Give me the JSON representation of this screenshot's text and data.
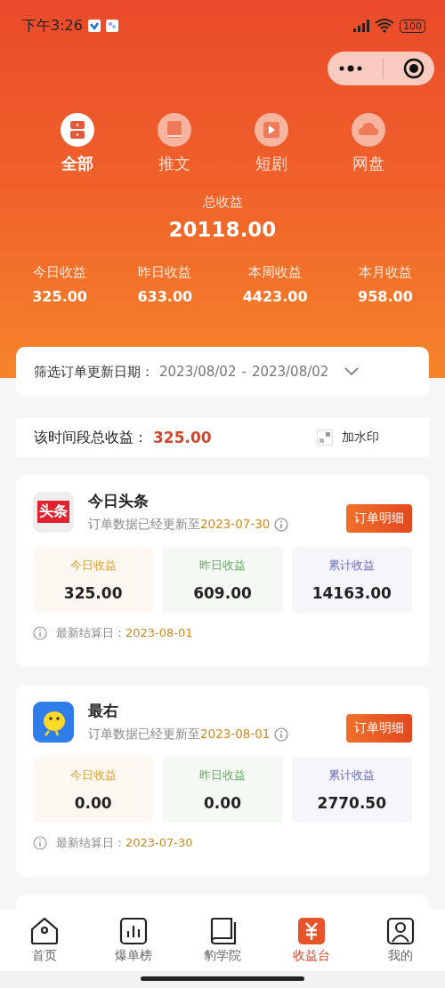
{
  "status_bar": {
    "time": "下午3:26",
    "battery": "100"
  },
  "categories": [
    {
      "label": "全部",
      "kind": "all",
      "selected": true
    },
    {
      "label": "推文",
      "kind": "book",
      "selected": false
    },
    {
      "label": "短剧",
      "kind": "video",
      "selected": false
    },
    {
      "label": "网盘",
      "kind": "cloud",
      "selected": false
    }
  ],
  "summary": {
    "label": "总收益",
    "value": "20118.00",
    "stats": [
      {
        "label": "今日收益",
        "value": "325.00"
      },
      {
        "label": "昨日收益",
        "value": "633.00"
      },
      {
        "label": "本周收益",
        "value": "4423.00"
      },
      {
        "label": "本月收益",
        "value": "958.00"
      }
    ]
  },
  "filter": {
    "label": "筛选订单更新日期：",
    "start": "2023/08/02",
    "separator": "-",
    "end": "2023/08/02"
  },
  "period_total": {
    "label": "该时间段总收益：",
    "value": "325.00",
    "watermark": {
      "label": "加水印",
      "checked": false
    }
  },
  "platforms": [
    {
      "name": "今日头条",
      "kind": "toutiao",
      "logo_text": "头条",
      "update_prefix": "订单数据已经更新至",
      "update_date": "2023-07-30",
      "button": "订单明细",
      "stats": [
        {
          "label": "今日收益",
          "value": "325.00",
          "color": "#d9a23c"
        },
        {
          "label": "昨日收益",
          "value": "609.00",
          "color": "#5fae5a"
        },
        {
          "label": "累计收益",
          "value": "14163.00",
          "color": "#6b6bbd"
        }
      ],
      "settle_label": "最新结算日：",
      "settle_date": "2023-08-01"
    },
    {
      "name": "最右",
      "kind": "zuiyou",
      "update_prefix": "订单数据已经更新至",
      "update_date": "2023-08-01",
      "button": "订单明细",
      "stats": [
        {
          "label": "今日收益",
          "value": "0.00",
          "color": "#d9a23c"
        },
        {
          "label": "昨日收益",
          "value": "0.00",
          "color": "#5fae5a"
        },
        {
          "label": "累计收益",
          "value": "2770.50",
          "color": "#6b6bbd"
        }
      ],
      "settle_label": "最新结算日：",
      "settle_date": "2023-07-30"
    }
  ],
  "tab_bar": [
    {
      "label": "首页",
      "kind": "home",
      "selected": false
    },
    {
      "label": "爆单榜",
      "kind": "chart",
      "selected": false
    },
    {
      "label": "豹学院",
      "kind": "book",
      "selected": false
    },
    {
      "label": "收益台",
      "kind": "yuan",
      "selected": true
    },
    {
      "label": "我的",
      "kind": "user",
      "selected": false
    }
  ]
}
